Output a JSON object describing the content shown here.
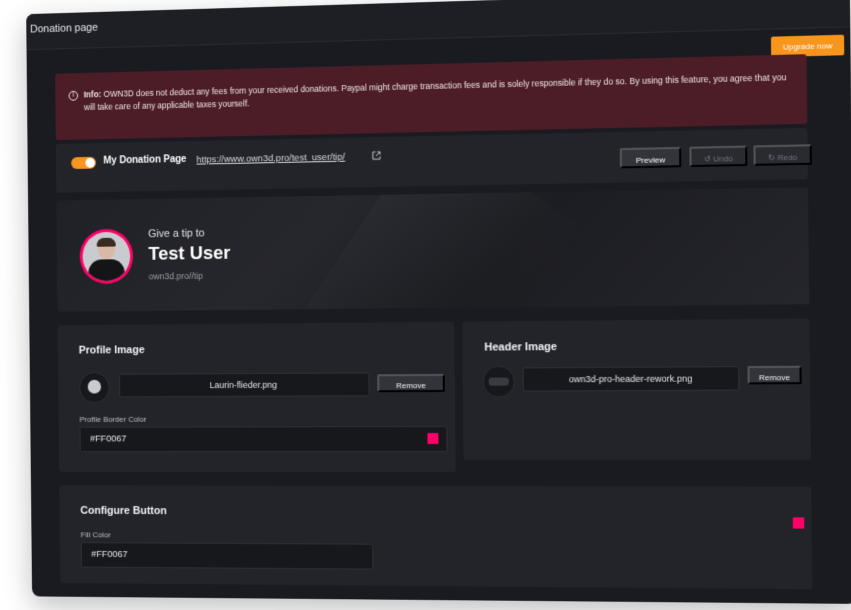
{
  "window": {
    "title": "Donation page"
  },
  "header": {
    "upgrade_label": "Upgrade now"
  },
  "info": {
    "label": "Info:",
    "text": " OWN3D does not deduct any fees from your received donations. Paypal might charge transaction fees and is solely responsible if they do so. By using this feature, you agree that you will take care of any applicable taxes yourself."
  },
  "toolbar": {
    "toggle_on": true,
    "label": "My Donation Page",
    "link": "https://www.own3d.pro/test_user/tip/",
    "preview_label": "Preview",
    "undo_label": "Undo",
    "redo_label": "Redo"
  },
  "banner": {
    "give_text": "Give a tip to",
    "username": "Test User",
    "url": "own3d.pro//tip"
  },
  "profile_image": {
    "title": "Profile Image",
    "filename": "Laurin-flieder.png",
    "remove_label": "Remove",
    "border_color_label": "Profile Border Color",
    "border_color_value": "#FF0067"
  },
  "header_image": {
    "title": "Header Image",
    "filename": "own3d-pro-header-rework.png",
    "remove_label": "Remove"
  },
  "configure_button": {
    "title": "Configure Button",
    "fill_color_label": "Fill Color",
    "fill_color_value": "#FF0067"
  },
  "colors": {
    "accent": "#f7951d",
    "brand_pink": "#FF0067",
    "info_bg": "#4c1d26"
  }
}
